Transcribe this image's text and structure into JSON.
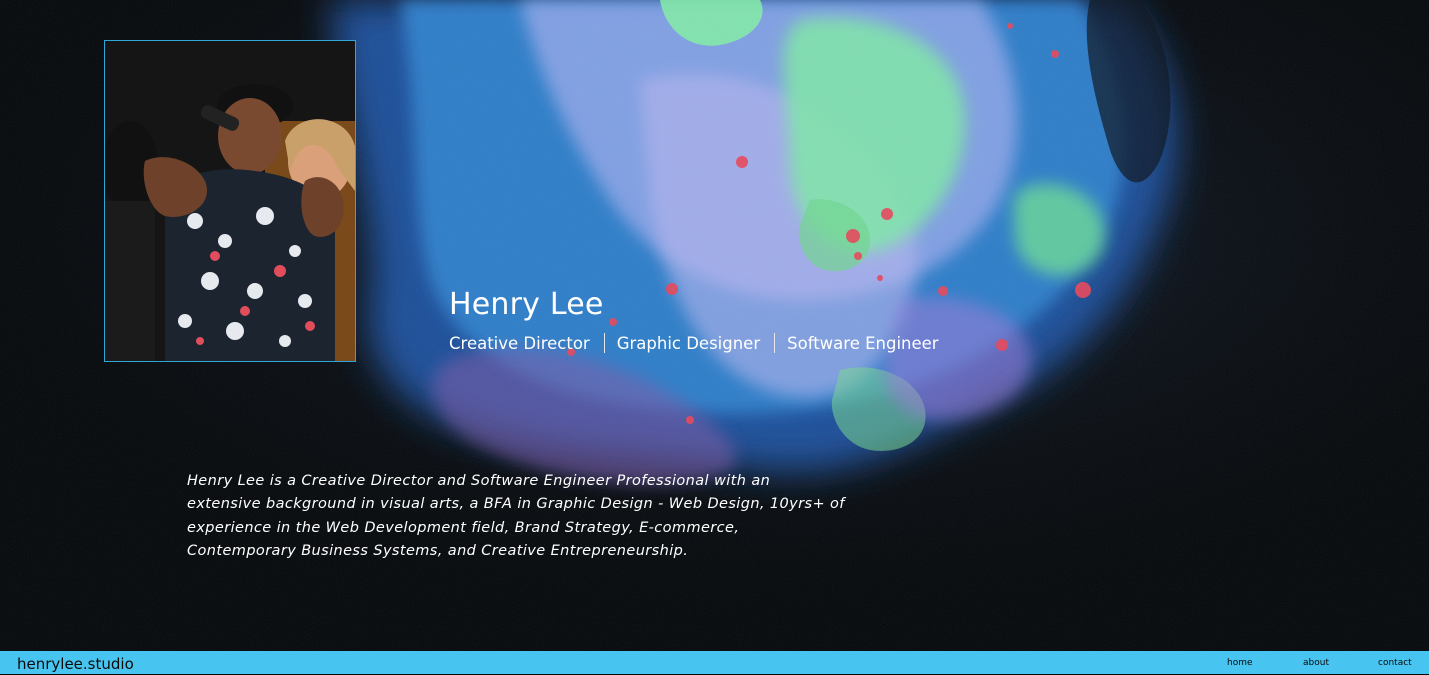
{
  "hero": {
    "name": "Henry Lee",
    "roles": [
      "Creative Director",
      "Graphic Designer",
      "Software Engineer"
    ],
    "bio": "Henry Lee is a Creative Director and Software Engineer Professional with an extensive background in visual arts, a BFA in Graphic Design - Web Design, 10yrs+ of experience in the Web Development field, Brand Strategy, E-commerce, Contemporary Business Systems, and Creative Entrepreneurship."
  },
  "footer": {
    "brand": "henrylee.studio",
    "nav": [
      {
        "label": "home"
      },
      {
        "label": "about"
      },
      {
        "label": "contact"
      }
    ]
  },
  "colors": {
    "accent": "#48c4f0",
    "background": "#05080b",
    "portrait_border": "#2fa8d8",
    "text": "#ffffff"
  }
}
